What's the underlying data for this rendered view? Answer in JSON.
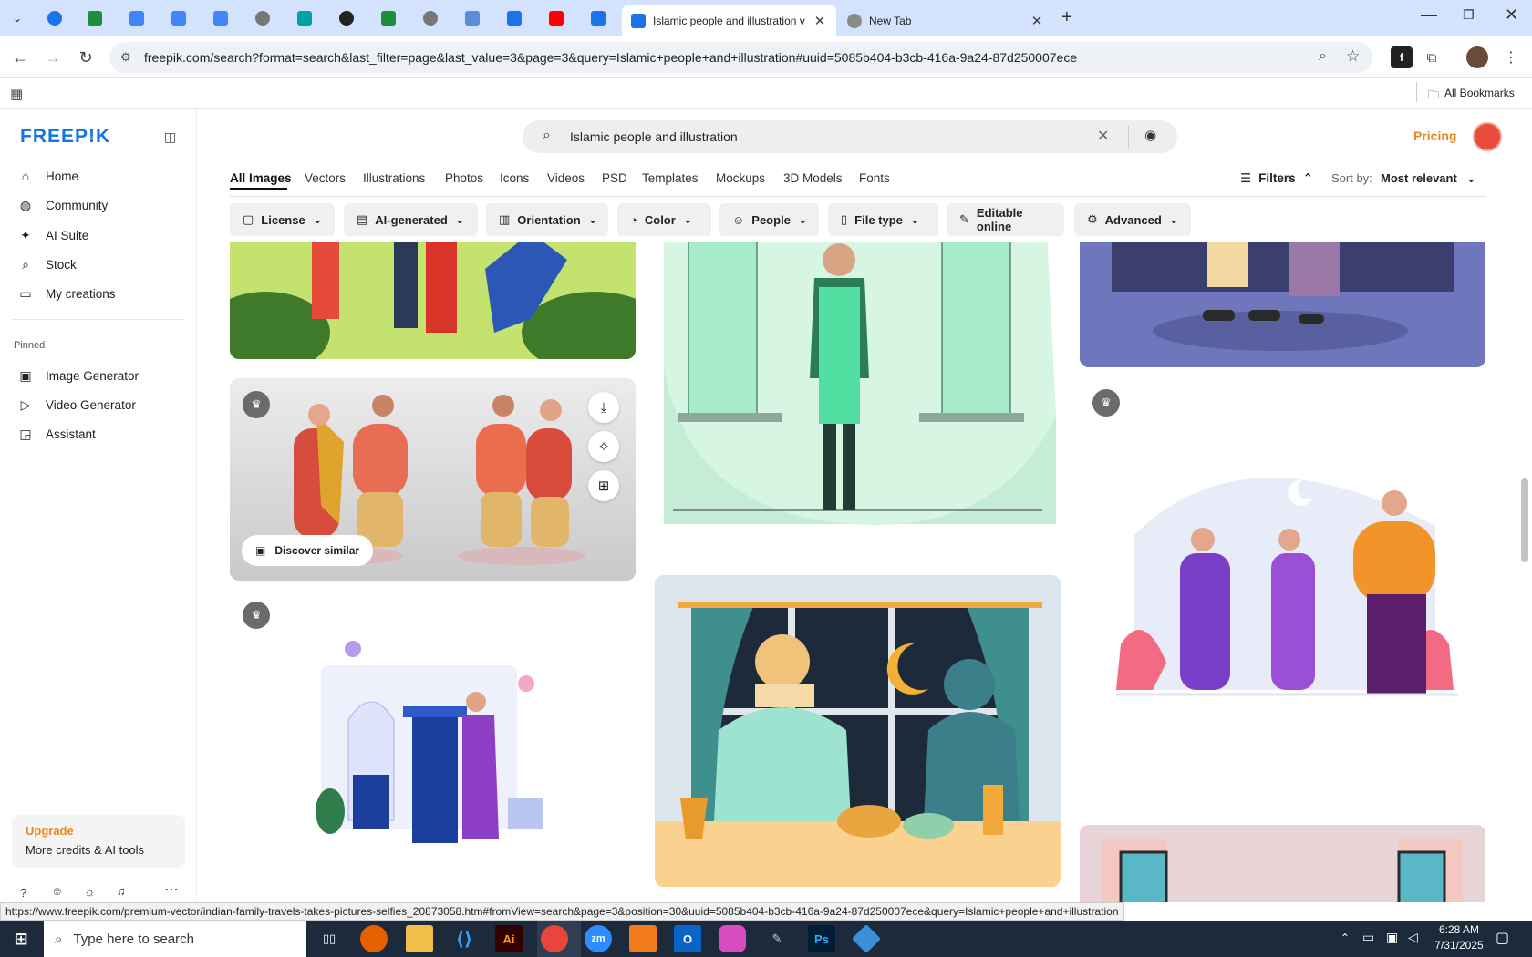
{
  "browser": {
    "tabs": [
      {
        "title": "Islamic people and illustration v",
        "active": true
      },
      {
        "title": "New Tab",
        "active": false
      }
    ],
    "url": "freepik.com/search?format=search&last_filter=page&last_value=3&page=3&query=Islamic+people+and+illustration#uuid=5085b404-b3cb-416a-9a24-87d250007ece",
    "all_bookmarks": "All Bookmarks",
    "status_url": "https://www.freepik.com/premium-vector/indian-family-travels-takes-pictures-selfies_20873058.htm#fromView=search&page=3&position=30&uuid=5085b404-b3cb-416a-9a24-87d250007ece&query=Islamic+people+and+illustration"
  },
  "sidebar": {
    "logo": "FREEP!K",
    "nav": [
      {
        "label": "Home",
        "icon": "home-icon"
      },
      {
        "label": "Community",
        "icon": "globe-icon"
      },
      {
        "label": "AI Suite",
        "icon": "sparkle-icon"
      },
      {
        "label": "Stock",
        "icon": "search-icon"
      },
      {
        "label": "My creations",
        "icon": "folder-icon"
      }
    ],
    "pinned_heading": "Pinned",
    "pinned": [
      {
        "label": "Image Generator",
        "icon": "image-icon"
      },
      {
        "label": "Video Generator",
        "icon": "video-icon"
      },
      {
        "label": "Assistant",
        "icon": "chat-icon"
      }
    ],
    "upgrade": {
      "title": "Upgrade",
      "subtitle": "More credits & AI tools"
    }
  },
  "header": {
    "search_value": "Islamic people and illustration",
    "pricing": "Pricing"
  },
  "tabs": [
    "All Images",
    "Vectors",
    "Illustrations",
    "Photos",
    "Icons",
    "Videos",
    "PSD",
    "Templates",
    "Mockups",
    "3D Models",
    "Fonts"
  ],
  "active_tab": "All Images",
  "filters_label": "Filters",
  "sort": {
    "label": "Sort by:",
    "value": "Most relevant"
  },
  "filter_buttons": [
    {
      "label": "License",
      "icon": "license-icon"
    },
    {
      "label": "AI-generated",
      "icon": "ai-icon"
    },
    {
      "label": "Orientation",
      "icon": "orientation-icon"
    },
    {
      "label": "Color",
      "icon": "palette-icon"
    },
    {
      "label": "People",
      "icon": "people-icon"
    },
    {
      "label": "File type",
      "icon": "file-icon"
    },
    {
      "label": "Editable online",
      "icon": "pencil-icon"
    },
    {
      "label": "Advanced",
      "icon": "gear-icon"
    }
  ],
  "results": {
    "discover_similar": "Discover similar"
  },
  "taskbar": {
    "search_placeholder": "Type here to search",
    "time": "6:28 AM",
    "date": "7/31/2025"
  },
  "colors": {
    "accent": "#1273eb",
    "pricing": "#e8871e",
    "tabstrip": "#d3e3fd",
    "taskbar": "#1c2a3b"
  }
}
